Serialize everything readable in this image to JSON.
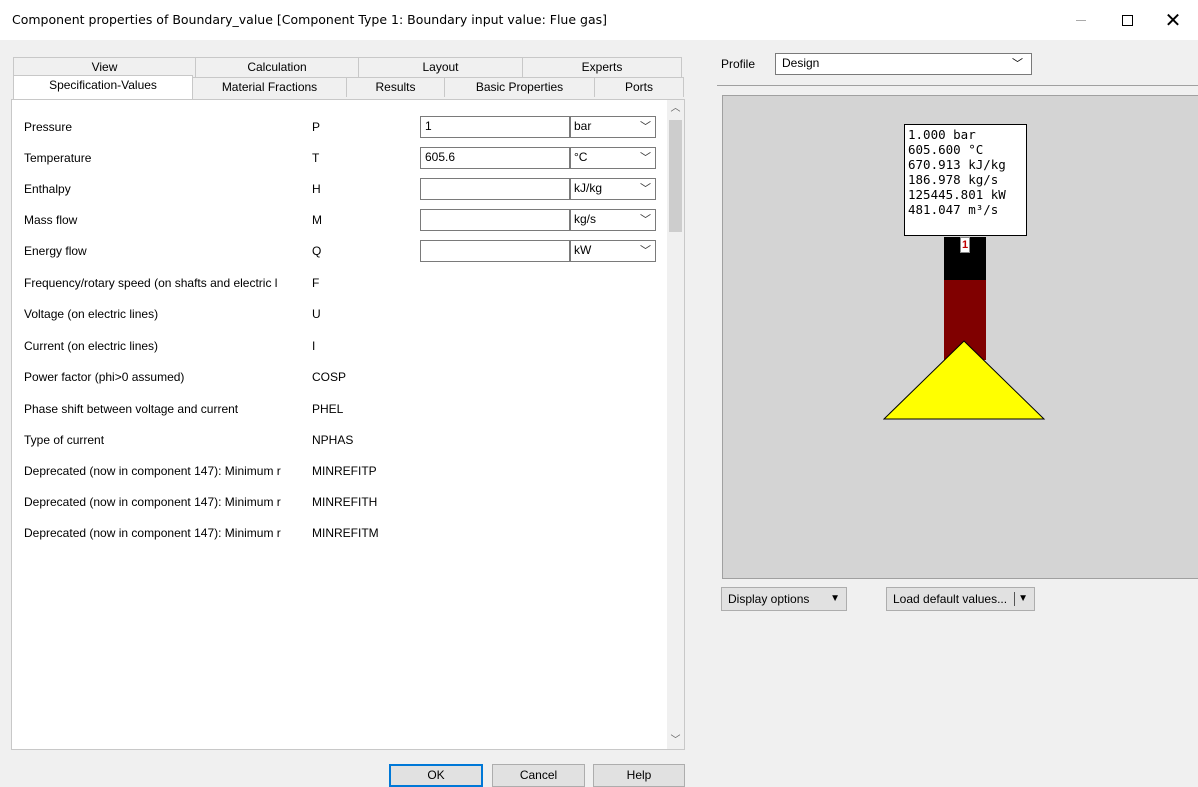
{
  "window": {
    "title": "Component properties of Boundary_value  [Component Type 1: Boundary input value: Flue gas]"
  },
  "tabs": {
    "back_row": [
      {
        "label": "View"
      },
      {
        "label": "Calculation"
      },
      {
        "label": "Layout"
      },
      {
        "label": "Experts"
      }
    ],
    "front_row": [
      {
        "label": "Specification-Values",
        "active": true
      },
      {
        "label": "Material Fractions"
      },
      {
        "label": "Results"
      },
      {
        "label": "Basic Properties"
      },
      {
        "label": "Ports"
      }
    ]
  },
  "specs": [
    {
      "label": "Pressure",
      "abbr": "P",
      "value": "1",
      "unit": "bar"
    },
    {
      "label": "Temperature",
      "abbr": "T",
      "value": "605.6",
      "unit": "°C"
    },
    {
      "label": "Enthalpy",
      "abbr": "H",
      "value": "",
      "unit": "kJ/kg"
    },
    {
      "label": "Mass flow",
      "abbr": "M",
      "value": "",
      "unit": "kg/s"
    },
    {
      "label": "Energy flow",
      "abbr": "Q",
      "value": "",
      "unit": "kW"
    },
    {
      "label": "Frequency/rotary speed (on shafts and electric l",
      "abbr": "F"
    },
    {
      "label": "Voltage (on electric lines)",
      "abbr": "U"
    },
    {
      "label": "Current (on electric lines)",
      "abbr": "I"
    },
    {
      "label": "Power factor (phi>0 assumed)",
      "abbr": "COSP"
    },
    {
      "label": "Phase shift between voltage and current",
      "abbr": "PHEL"
    },
    {
      "label": "Type of current",
      "abbr": "NPHAS"
    },
    {
      "label": "Deprecated (now in component 147): Minimum r",
      "abbr": "MINREFITP"
    },
    {
      "label": "Deprecated (now in component 147): Minimum r",
      "abbr": "MINREFITH"
    },
    {
      "label": "Deprecated (now in component 147): Minimum r",
      "abbr": "MINREFITM"
    }
  ],
  "buttons": {
    "ok": "OK",
    "cancel": "Cancel",
    "help": "Help"
  },
  "profile": {
    "label": "Profile",
    "selected": "Design"
  },
  "canvas": {
    "info_lines": [
      "1.000 bar",
      "605.600 °C",
      "670.913 kJ/kg",
      "186.978 kg/s",
      "125445.801 kW",
      "481.047 m³/s"
    ],
    "port_label": "1"
  },
  "options": {
    "display": "Display options",
    "load": "Load default values..."
  },
  "colors": {
    "accent": "#0078d7",
    "pipe_black": "#000000",
    "pipe_red": "#800000",
    "triangle": "#ffff00",
    "canvas_bg": "#d4d4d4"
  }
}
